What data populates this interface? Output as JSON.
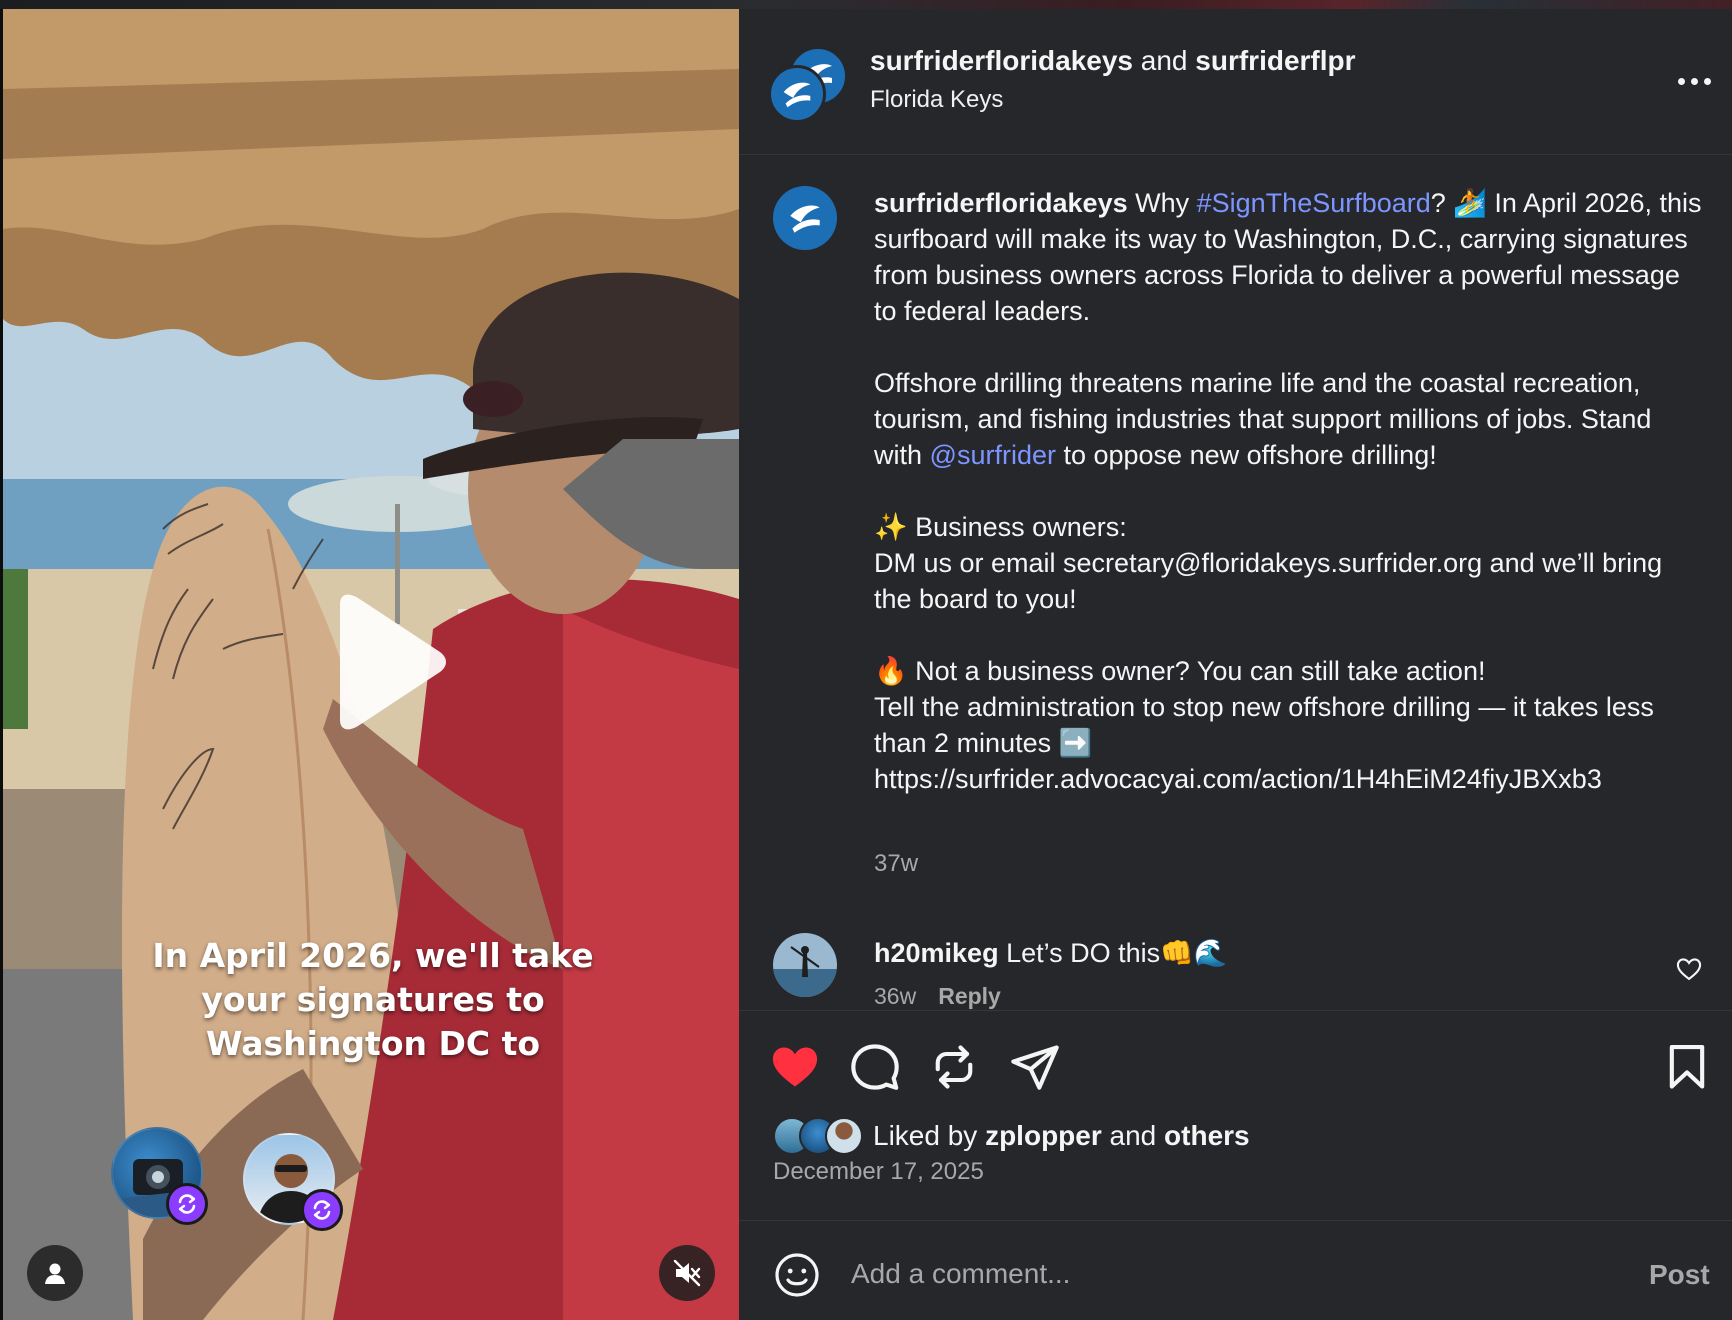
{
  "header": {
    "user1": "surfriderfloridakeys",
    "and": " and ",
    "user2": "surfriderflpr",
    "location": "Florida Keys",
    "more_icon": "more-horizontal-icon"
  },
  "media": {
    "overlay_caption": "In April 2026, we'll take\nyour signatures to\nWashington DC to",
    "play_icon": "play-icon",
    "tag_icon": "user-tag-icon",
    "mute_icon": "speaker-muted-icon",
    "collab_icon": "repost-icon"
  },
  "caption": {
    "username": "surfriderfloridakeys",
    "p1_pre": " Why ",
    "hashtag": "#SignTheSurfboard",
    "p1_post": "? 🏄 In April 2026, this surfboard will make its way to Washington, D.C., carrying signatures from business owners across Florida to deliver a powerful message to federal leaders.",
    "p2_pre": "Offshore drilling threatens marine life and the coastal recreation, tourism, and fishing industries that support millions of jobs. Stand with ",
    "mention": "@surfrider",
    "p2_post": " to oppose new offshore drilling!",
    "p3": "✨ Business owners:\nDM us or email secretary@floridakeys.surfrider.org and we’ll bring the board to you!",
    "p4": "🔥 Not a business owner? You can still take action!\nTell the administration to stop new offshore drilling — it takes less than 2 minutes ➡️\nhttps://surfrider.advocacyai.com/action/1H4hEiM24fiyJBXxb3",
    "time": "37w"
  },
  "comments": [
    {
      "username": "h20mikeg",
      "text": " Let’s DO this👊🌊",
      "time": "36w",
      "reply": "Reply"
    }
  ],
  "actions": {
    "like_icon": "heart-filled-icon",
    "comment_icon": "comment-icon",
    "repost_icon": "repost-icon",
    "share_icon": "share-icon",
    "save_icon": "bookmark-icon",
    "liked_by_pre": "Liked by ",
    "liked_by_user": "zplopper",
    "liked_by_mid": " and ",
    "liked_by_others": "others",
    "date": "December 17, 2025"
  },
  "add_comment": {
    "placeholder": "Add a comment...",
    "post_label": "Post",
    "emoji_icon": "emoji-icon"
  },
  "colors": {
    "panel_bg": "#25272b",
    "link": "#7d95ff",
    "like_red": "#ff3040",
    "brand_blue": "#1d6fb5",
    "collab_purple": "#8b3dff"
  }
}
